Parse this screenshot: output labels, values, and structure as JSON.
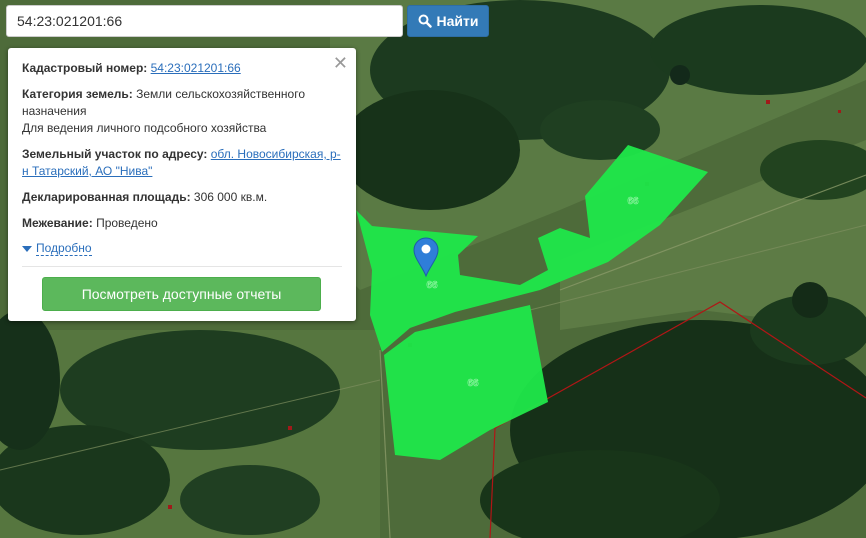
{
  "search": {
    "value": "54:23:021201:66",
    "button_label": "Найти",
    "button_icon": "search-icon"
  },
  "popup": {
    "close_icon": "close-icon",
    "cadastral_label": "Кадастровый номер:",
    "cadastral_value": "54:23:021201:66",
    "category_label": "Категория земель:",
    "category_value": "Земли сельскохозяйственного назначения",
    "use_value": "Для ведения личного подсобного хозяйства",
    "address_label": "Земельный участок по адресу:",
    "address_value": "обл. Новосибирская, р-н Татарский, АО \"Нива\"",
    "area_label": "Декларированная площадь:",
    "area_value": "306 000 кв.м.",
    "survey_label": "Межевание:",
    "survey_value": "Проведено",
    "more_label": "Подробно",
    "reports_button": "Посмотреть доступные отчеты"
  },
  "map": {
    "parcel_labels": [
      "66",
      "66",
      "66"
    ],
    "parcel_color": "#1fe84a",
    "boundary_color": "#b01616",
    "marker_color": "#2f7ed8",
    "marker_icon": "map-pin-icon"
  }
}
